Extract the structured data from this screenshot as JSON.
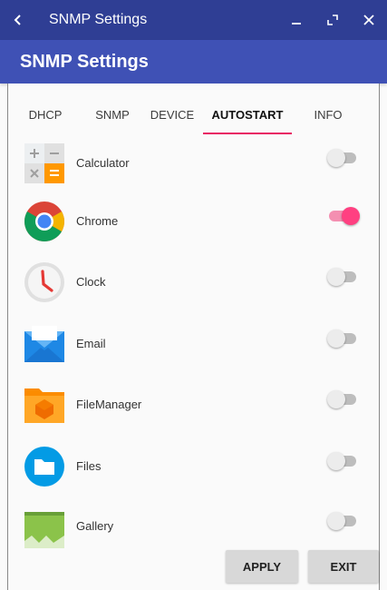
{
  "window": {
    "title": "SNMP Settings",
    "back_icon": "chevron-left-icon",
    "minimize_icon": "minimize-icon",
    "restore_icon": "restore-icon",
    "close_icon": "close-icon"
  },
  "appbar": {
    "title": "SNMP Settings",
    "color": "#3f51b5"
  },
  "tabs": [
    {
      "label": "DHCP",
      "active": false
    },
    {
      "label": "SNMP",
      "active": false
    },
    {
      "label": "DEVICE",
      "active": false
    },
    {
      "label": "AUTOSTART",
      "active": true
    },
    {
      "label": "INFO",
      "active": false
    }
  ],
  "apps": [
    {
      "label": "Calculator",
      "icon": "calculator-icon",
      "enabled": false
    },
    {
      "label": "Chrome",
      "icon": "chrome-icon",
      "enabled": true
    },
    {
      "label": "Clock",
      "icon": "clock-icon",
      "enabled": false
    },
    {
      "label": "Email",
      "icon": "email-icon",
      "enabled": false
    },
    {
      "label": "FileManager",
      "icon": "file-manager-icon",
      "enabled": false
    },
    {
      "label": "Files",
      "icon": "files-icon",
      "enabled": false
    },
    {
      "label": "Gallery",
      "icon": "gallery-icon",
      "enabled": false
    }
  ],
  "buttons": {
    "apply": "APPLY",
    "exit": "EXIT"
  },
  "colors": {
    "accent": "#ff4081",
    "titlebar": "#2f3e94",
    "tab_indicator": "#e91e63"
  }
}
